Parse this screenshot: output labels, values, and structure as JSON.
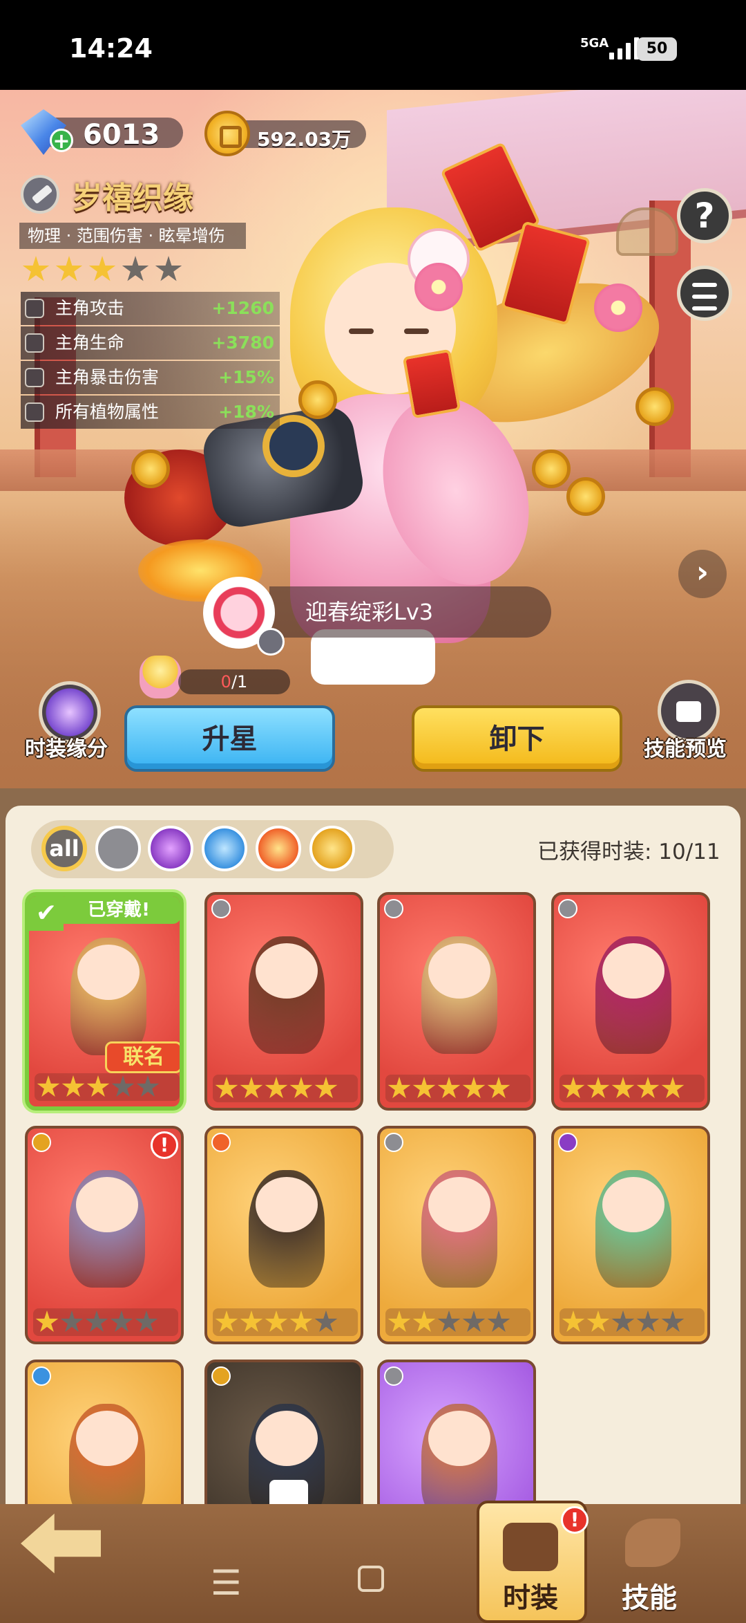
{
  "status_bar": {
    "time": "14:24",
    "network": "5GA",
    "battery": "50"
  },
  "currency": {
    "gems": "6013",
    "gold": "592.03万"
  },
  "costume": {
    "name": "岁禧织缘",
    "tags": "物理 · 范围伤害 · 眩晕增伤",
    "star_rating": 3,
    "star_max": 5,
    "stats": [
      {
        "label": "主角攻击",
        "value": "+1260"
      },
      {
        "label": "主角生命",
        "value": "+3780"
      },
      {
        "label": "主角暴击伤害",
        "value": "+15%"
      },
      {
        "label": "所有植物属性",
        "value": "+18%"
      }
    ],
    "skill_name": "迎春绽彩Lv3",
    "shards": {
      "current": "0",
      "total": "/1"
    }
  },
  "actions": {
    "fate_label": "时装缘分",
    "upgrade_label": "升星",
    "unequip_label": "卸下",
    "preview_label": "技能预览"
  },
  "filters": {
    "all_label": "all",
    "items": [
      "all",
      "physical",
      "poison",
      "water",
      "fire",
      "electric"
    ]
  },
  "owned_text": "已获得时装: 10/11",
  "cards": [
    {
      "element": "physical",
      "rarity": "red",
      "stars": 3,
      "worn_label": "已穿戴!",
      "badge": "联名"
    },
    {
      "element": "physical",
      "rarity": "red",
      "stars": 5
    },
    {
      "element": "physical",
      "rarity": "red",
      "stars": 5
    },
    {
      "element": "physical",
      "rarity": "red",
      "stars": 5
    },
    {
      "element": "electric",
      "rarity": "red",
      "stars": 1,
      "alert": "!"
    },
    {
      "element": "fire",
      "rarity": "gold",
      "stars": 4
    },
    {
      "element": "physical",
      "rarity": "gold",
      "stars": 2
    },
    {
      "element": "poison",
      "rarity": "gold",
      "stars": 2
    },
    {
      "element": "water",
      "rarity": "gold",
      "stars": 0
    },
    {
      "element": "electric",
      "rarity": "dark",
      "stars": 0,
      "locked": true
    },
    {
      "element": "physical",
      "rarity": "purple",
      "stars": 0
    }
  ],
  "bottom_nav": {
    "costume_label": "时装",
    "skill_label": "技能",
    "costume_alert": "!"
  },
  "system_nav": {
    "menu": "☰"
  }
}
